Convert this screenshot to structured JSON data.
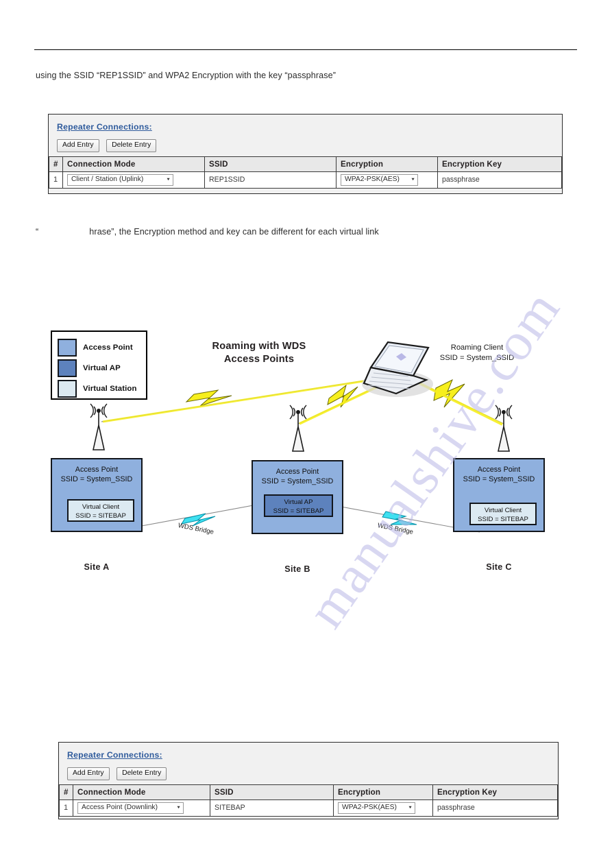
{
  "document": {
    "intro_text": "using the SSID “REP1SSID” and WPA2 Encryption with the key “passphrase”",
    "mid_text_prefix": "“",
    "mid_text_suffix": "hrase”, the Encryption method and key can be different for each virtual link",
    "watermark": "manualshive.com"
  },
  "panel_top": {
    "title": "Repeater Connections:",
    "add_entry_label": "Add Entry",
    "delete_entry_label": "Delete Entry",
    "columns": [
      "#",
      "Connection Mode",
      "SSID",
      "Encryption",
      "Encryption Key"
    ],
    "rows": [
      {
        "num": "1",
        "mode": "Client / Station (Uplink)",
        "ssid": "REP1SSID",
        "encryption": "WPA2-PSK(AES)",
        "key": "passphrase"
      }
    ]
  },
  "panel_bottom": {
    "title": "Repeater Connections:",
    "add_entry_label": "Add Entry",
    "delete_entry_label": "Delete Entry",
    "columns": [
      "#",
      "Connection Mode",
      "SSID",
      "Encryption",
      "Encryption Key"
    ],
    "rows": [
      {
        "num": "1",
        "mode": "Access Point (Downlink)",
        "ssid": "SITEBAP",
        "encryption": "WPA2-PSK(AES)",
        "key": "passphrase"
      }
    ]
  },
  "diagram": {
    "title_line1": "Roaming with WDS",
    "title_line2": "Access Points",
    "legend": {
      "items": [
        {
          "label": "Access Point",
          "color": "#8fb0de"
        },
        {
          "label": "Virtual AP",
          "color": "#5d82bd"
        },
        {
          "label": "Virtual Station",
          "color": "#dceaf2"
        }
      ]
    },
    "roaming_client": {
      "line1": "Roaming Client",
      "line2": "SSID  = System_SSID"
    },
    "sites": [
      {
        "name": "Site A",
        "head_line1": "Access Point",
        "head_line2": "SSID  = System_SSID",
        "inner_kind": "Virtual Station",
        "inner_line1": "Virtual Client",
        "inner_line2": "SSID = SITEBAP"
      },
      {
        "name": "Site B",
        "head_line1": "Access Point",
        "head_line2": "SSID  = System_SSID",
        "inner_kind": "Virtual AP",
        "inner_line1": "Virtual AP",
        "inner_line2": "SSID =  SITEBAP"
      },
      {
        "name": "Site C",
        "head_line1": "Access Point",
        "head_line2": "SSID  = System_SSID",
        "inner_kind": "Virtual Station",
        "inner_line1": "Virtual Client",
        "inner_line2": "SSID = SITEBAP"
      }
    ],
    "links": [
      {
        "label_a": "WDS",
        "label_b": "Bridge"
      },
      {
        "label_a": "WDS",
        "label_b": "Bridge"
      }
    ],
    "colors": {
      "wireless_bolt": "#f7ef1d",
      "wds_bolt": "#3fe0f0",
      "access_point": "#8fb0de",
      "virtual_ap": "#5d82bd",
      "virtual_station": "#dceaf2"
    }
  }
}
